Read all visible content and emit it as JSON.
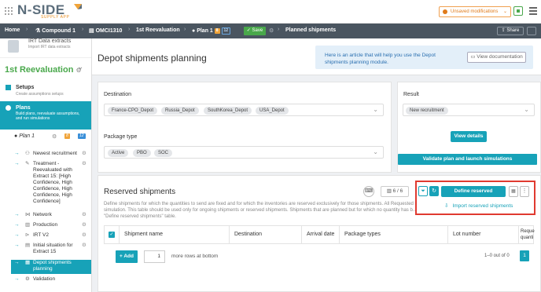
{
  "header": {
    "logo_text": "N-SIDE",
    "logo_subtitle": "SUPPLY APP",
    "unsaved_label": "Unsaved modifications"
  },
  "breadcrumb": {
    "home": "Home",
    "compound": "Compound 1",
    "study": "OMCI1310",
    "reevaluation": "1st Reevaluation",
    "plan": "Plan 1",
    "plan_badge1": "8",
    "plan_badge2": "12",
    "save": "Save",
    "current": "Planned shipments",
    "share": "Share"
  },
  "sidebar": {
    "top_title": "IRT Data extracts",
    "top_subtitle": "Import IRT data extracts",
    "reevaluation_title": "1st Reevaluation",
    "setups_title": "Setups",
    "setups_subtitle": "Create assumptions setups",
    "plans_title": "Plans",
    "plans_subtitle": "Build plans, reevaluate assumptions, and run simulations",
    "plan_name": "Plan 1",
    "plan_badge1": "8",
    "plan_badge2": "12",
    "items": [
      {
        "label": "Newest recruitment"
      },
      {
        "label": "Treatment - Reevaluated with Extract 15: [High Confidence, High Confidence, High Confidence, High Confidence]"
      },
      {
        "label": "Network"
      },
      {
        "label": "Production"
      },
      {
        "label": "IRT V2"
      },
      {
        "label": "Initial situation for Extract 15"
      },
      {
        "label": "Depot shipments planning"
      },
      {
        "label": "Validation"
      }
    ]
  },
  "page": {
    "title": "Depot shipments planning",
    "info_text": "Here is an article that will help you use the Depot shipments planning module.",
    "view_doc": "View documentation"
  },
  "form": {
    "destination_label": "Destination",
    "destinations": [
      "France-CPO_Depot",
      "Russia_Depot",
      "SouthKorea_Depot",
      "USA_Depot"
    ],
    "package_label": "Package type",
    "packages": [
      "Active",
      "PBO",
      "SOC"
    ],
    "result_label": "Result",
    "result_value": "New recruitment",
    "view_details": "View details",
    "validate_btn": "Validate plan and launch simulations"
  },
  "reserved": {
    "title": "Reserved shipments",
    "description": "Define shipments for which the quantities to send are fixed and for which the inventories are reserved exclusively for those shipments. All Requested kits... the simulation. This table should be used only for ongoing shipments or reserved shipments. Shipments that are planned but for which no quantity has b... the \"Define reserved shipments\" table.",
    "counter": "6 / 6",
    "define_btn": "Define reserved shipments",
    "import_link": "Import reserved shipments",
    "columns": [
      "Shipment name",
      "Destination",
      "Arrival date",
      "Package types",
      "Lot number",
      "Reque quanti"
    ],
    "add_btn": "Add",
    "rows_count": "1",
    "more_rows": "more rows at bottom",
    "pagination": "1–0 out of 0",
    "page_num": "1"
  }
}
